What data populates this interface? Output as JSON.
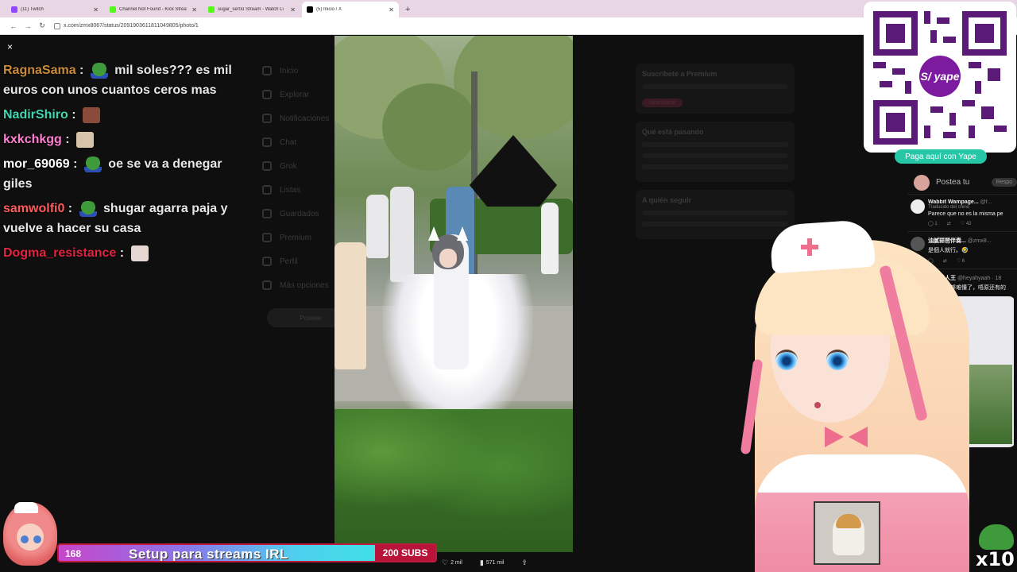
{
  "browser": {
    "tabs": [
      {
        "title": "(11) Twitch",
        "favicon_color": "#9146ff",
        "active": false
      },
      {
        "title": "Channel Not Found - Kick Strea",
        "favicon_color": "#53fc18",
        "active": false
      },
      {
        "title": "sugar_ser0o Stream - Watch Li",
        "favicon_color": "#53fc18",
        "active": false
      },
      {
        "title": "(5) Inicio / X",
        "favicon_color": "#000000",
        "active": true
      }
    ],
    "new_tab": "+",
    "url": "x.com/zmx8067/status/2091903611811049805/photo/1"
  },
  "chat": {
    "close": "×",
    "messages": [
      {
        "user": "RagnaSama",
        "color": "#c98a3a",
        "emote": "pepe",
        "text": "mil soles??? es mil euros con unos cuantos ceros mas"
      },
      {
        "user": "NadirShiro",
        "color": "#3fd6b0",
        "emote": "face",
        "text": ""
      },
      {
        "user": "kxkchkgg",
        "color": "#ff7fd1",
        "emote": "cat",
        "text": ""
      },
      {
        "user": "mor_69069",
        "color": "#ffffff",
        "emote": "pepe",
        "text": "oe se va a denegar giles"
      },
      {
        "user": "samwolfi0",
        "color": "#ff5a5a",
        "emote": "pepe",
        "text": "shugar agarra paja y vuelve a hacer su casa"
      },
      {
        "user": "Dogma_resistance",
        "color": "#e0253f",
        "emote": "pale",
        "text": ""
      }
    ]
  },
  "subgoal": {
    "count": "168",
    "title": "Setup para streams IRL",
    "goal": "200 SUBS",
    "progress": 0.84
  },
  "photo_stats": {
    "likes": "2 mil",
    "views": "571 mil"
  },
  "yape": {
    "logo": "S/ yape",
    "button": "Paga aquí con Yape"
  },
  "x_side": {
    "compose_placeholder": "Postea tu",
    "reply_btn": "Respo",
    "tweets": [
      {
        "name": "Wabbit Wampage...",
        "handle": "@f...",
        "translated": "Traducido del chino",
        "text": "Parece que no es la misma pe",
        "stats": [
          "1",
          "42"
        ]
      },
      {
        "name": "油腻琵琶伴奏...",
        "handle": "@zmx8...",
        "translated": "",
        "text": "是個人就行。🤣",
        "stats": [
          "",
          "6"
        ]
      },
      {
        "name": "超级爱人王",
        "handle": "@heyahyaah · 18",
        "translated": "",
        "text": "本来已经够难懂了，唔原还有的",
        "stats": []
      }
    ]
  },
  "x_background": {
    "nav": [
      "Inicio",
      "Explorar",
      "Notificaciones",
      "Chat",
      "Grok",
      "Listas",
      "Guardados",
      "Premium",
      "Perfil",
      "Más opciones"
    ],
    "post": "Postear",
    "premium_title": "Suscríbete a Premium",
    "premium_button": "Suscribirse",
    "happening": "Qué está pasando",
    "follow": "A quién seguir"
  },
  "x10_label": "x10"
}
